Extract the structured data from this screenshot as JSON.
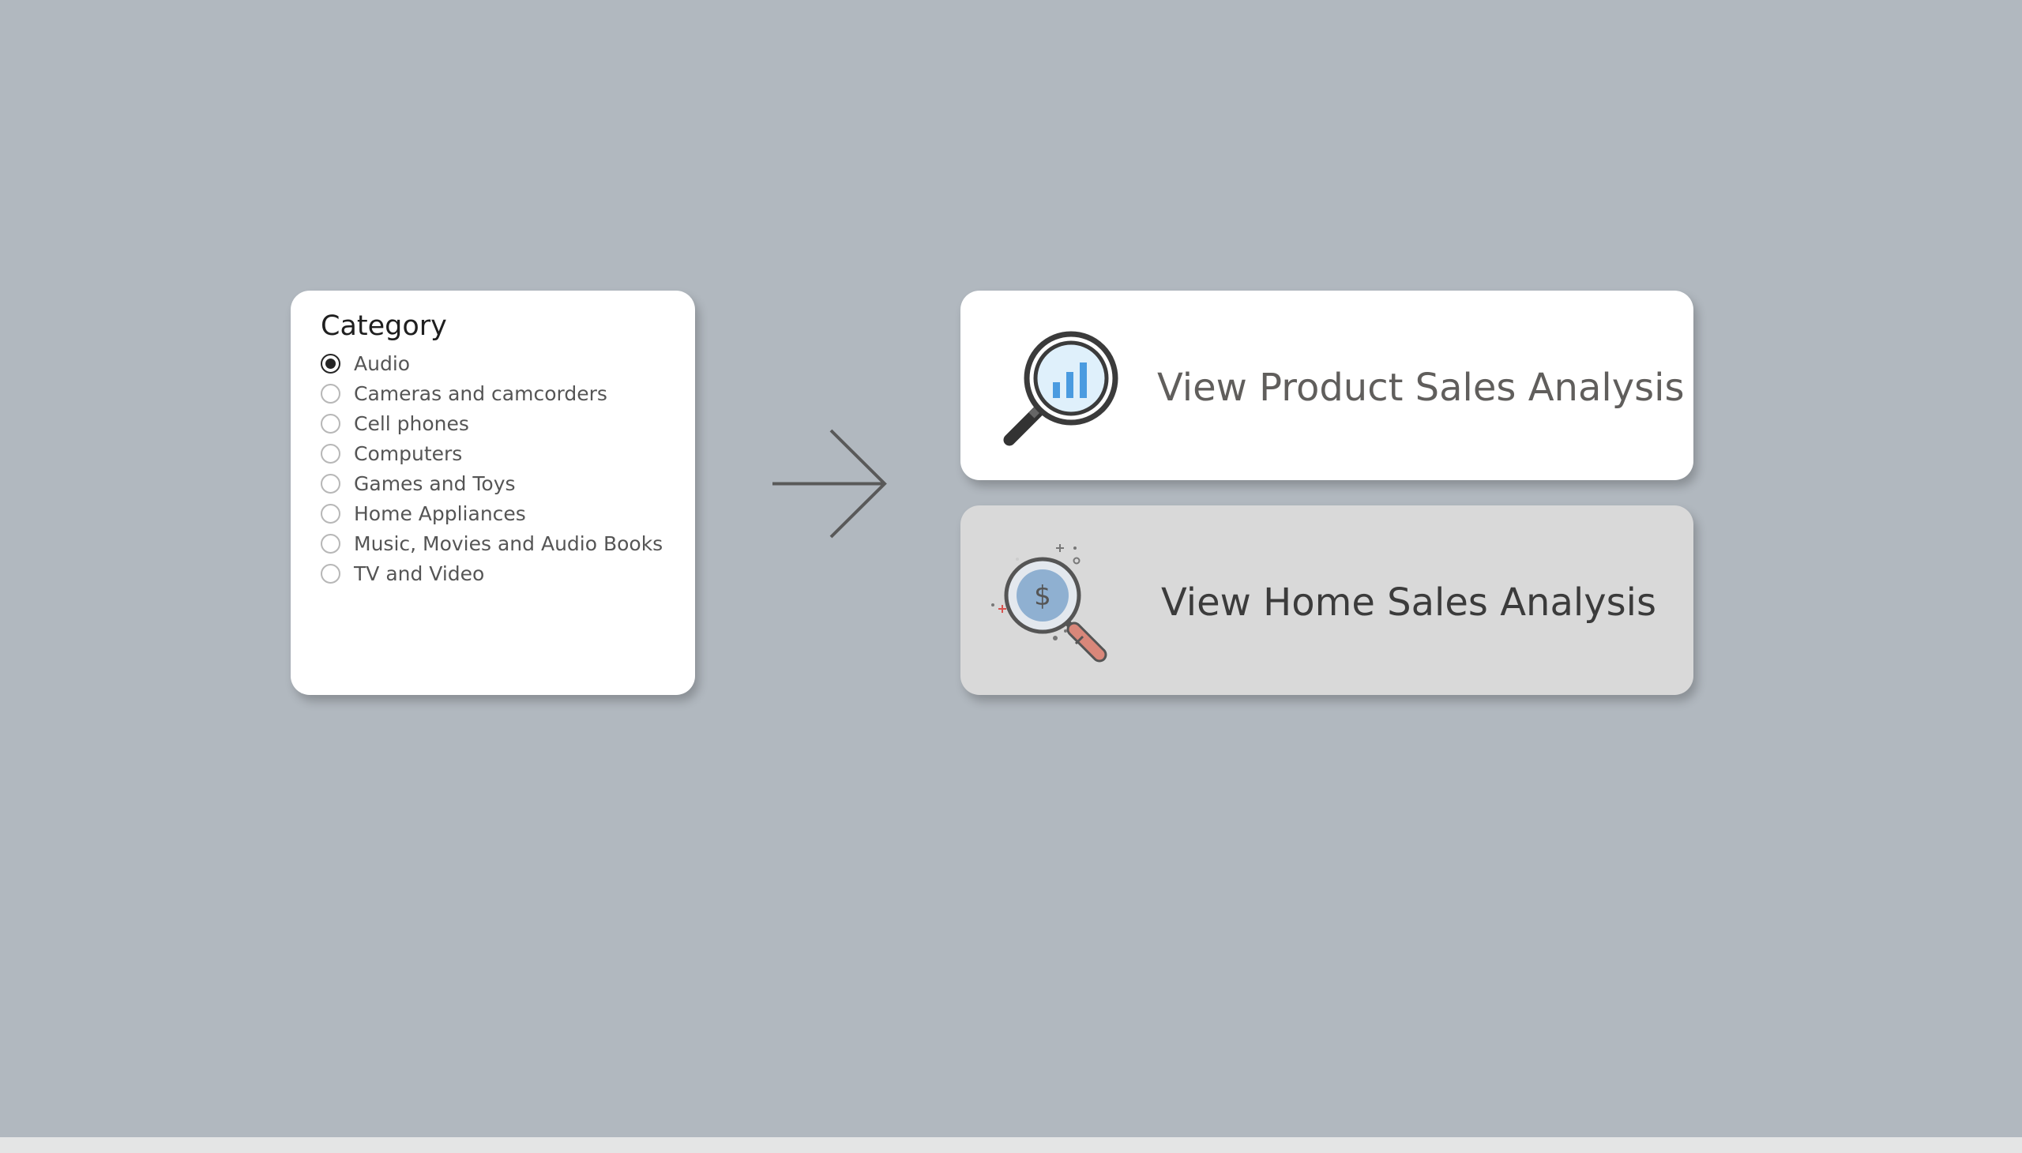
{
  "category_slicer": {
    "title": "Category",
    "selected": "Audio",
    "options": [
      {
        "label": "Audio",
        "selected": true
      },
      {
        "label": "Cameras and camcorders",
        "selected": false
      },
      {
        "label": "Cell phones",
        "selected": false
      },
      {
        "label": "Computers",
        "selected": false
      },
      {
        "label": "Games and Toys",
        "selected": false
      },
      {
        "label": "Home Appliances",
        "selected": false
      },
      {
        "label": "Music, Movies and Audio Books",
        "selected": false
      },
      {
        "label": "TV and Video",
        "selected": false
      }
    ]
  },
  "arrow": {
    "icon": "arrow-right-icon"
  },
  "buttons": {
    "product": {
      "label": "View Product Sales Analysis",
      "icon": "magnifier-bar-chart-icon",
      "background": "#ffffff"
    },
    "home": {
      "label": "View Home Sales Analysis",
      "icon": "magnifier-dollar-icon",
      "background": "#d9d9d9"
    }
  },
  "colors": {
    "page_background": "#b1b8bf",
    "card_background": "#ffffff",
    "chart_bar_blue": "#4a9be0",
    "dollar_circle": "#8fb0d1",
    "handle_red": "#d9877a"
  }
}
